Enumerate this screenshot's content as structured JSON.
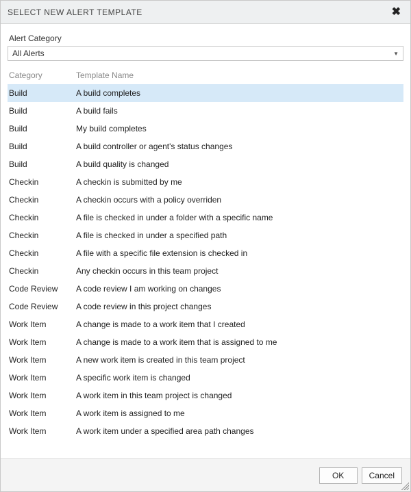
{
  "dialog": {
    "title": "SELECT NEW ALERT TEMPLATE"
  },
  "category": {
    "label": "Alert Category",
    "selected": "All Alerts"
  },
  "columns": {
    "category": "Category",
    "templateName": "Template Name"
  },
  "rows": [
    {
      "category": "Build",
      "name": "A build completes",
      "selected": true
    },
    {
      "category": "Build",
      "name": "A build fails",
      "selected": false
    },
    {
      "category": "Build",
      "name": "My build completes",
      "selected": false
    },
    {
      "category": "Build",
      "name": "A build controller or agent's status changes",
      "selected": false
    },
    {
      "category": "Build",
      "name": "A build quality is changed",
      "selected": false
    },
    {
      "category": "Checkin",
      "name": "A checkin is submitted by me",
      "selected": false
    },
    {
      "category": "Checkin",
      "name": "A checkin occurs with a policy overriden",
      "selected": false
    },
    {
      "category": "Checkin",
      "name": "A file is checked in under a folder with a specific name",
      "selected": false
    },
    {
      "category": "Checkin",
      "name": "A file is checked in under a specified path",
      "selected": false
    },
    {
      "category": "Checkin",
      "name": "A file with a specific file extension is checked in",
      "selected": false
    },
    {
      "category": "Checkin",
      "name": "Any checkin occurs in this team project",
      "selected": false
    },
    {
      "category": "Code Review",
      "name": "A code review I am working on changes",
      "selected": false
    },
    {
      "category": "Code Review",
      "name": "A code review in this project changes",
      "selected": false
    },
    {
      "category": "Work Item",
      "name": "A change is made to a work item that I created",
      "selected": false
    },
    {
      "category": "Work Item",
      "name": "A change is made to a work item that is assigned to me",
      "selected": false
    },
    {
      "category": "Work Item",
      "name": "A new work item is created in this team project",
      "selected": false
    },
    {
      "category": "Work Item",
      "name": "A specific work item is changed",
      "selected": false
    },
    {
      "category": "Work Item",
      "name": "A work item in this team project is changed",
      "selected": false
    },
    {
      "category": "Work Item",
      "name": "A work item is assigned to me",
      "selected": false
    },
    {
      "category": "Work Item",
      "name": "A work item under a specified area path changes",
      "selected": false
    }
  ],
  "buttons": {
    "ok": "OK",
    "cancel": "Cancel"
  }
}
